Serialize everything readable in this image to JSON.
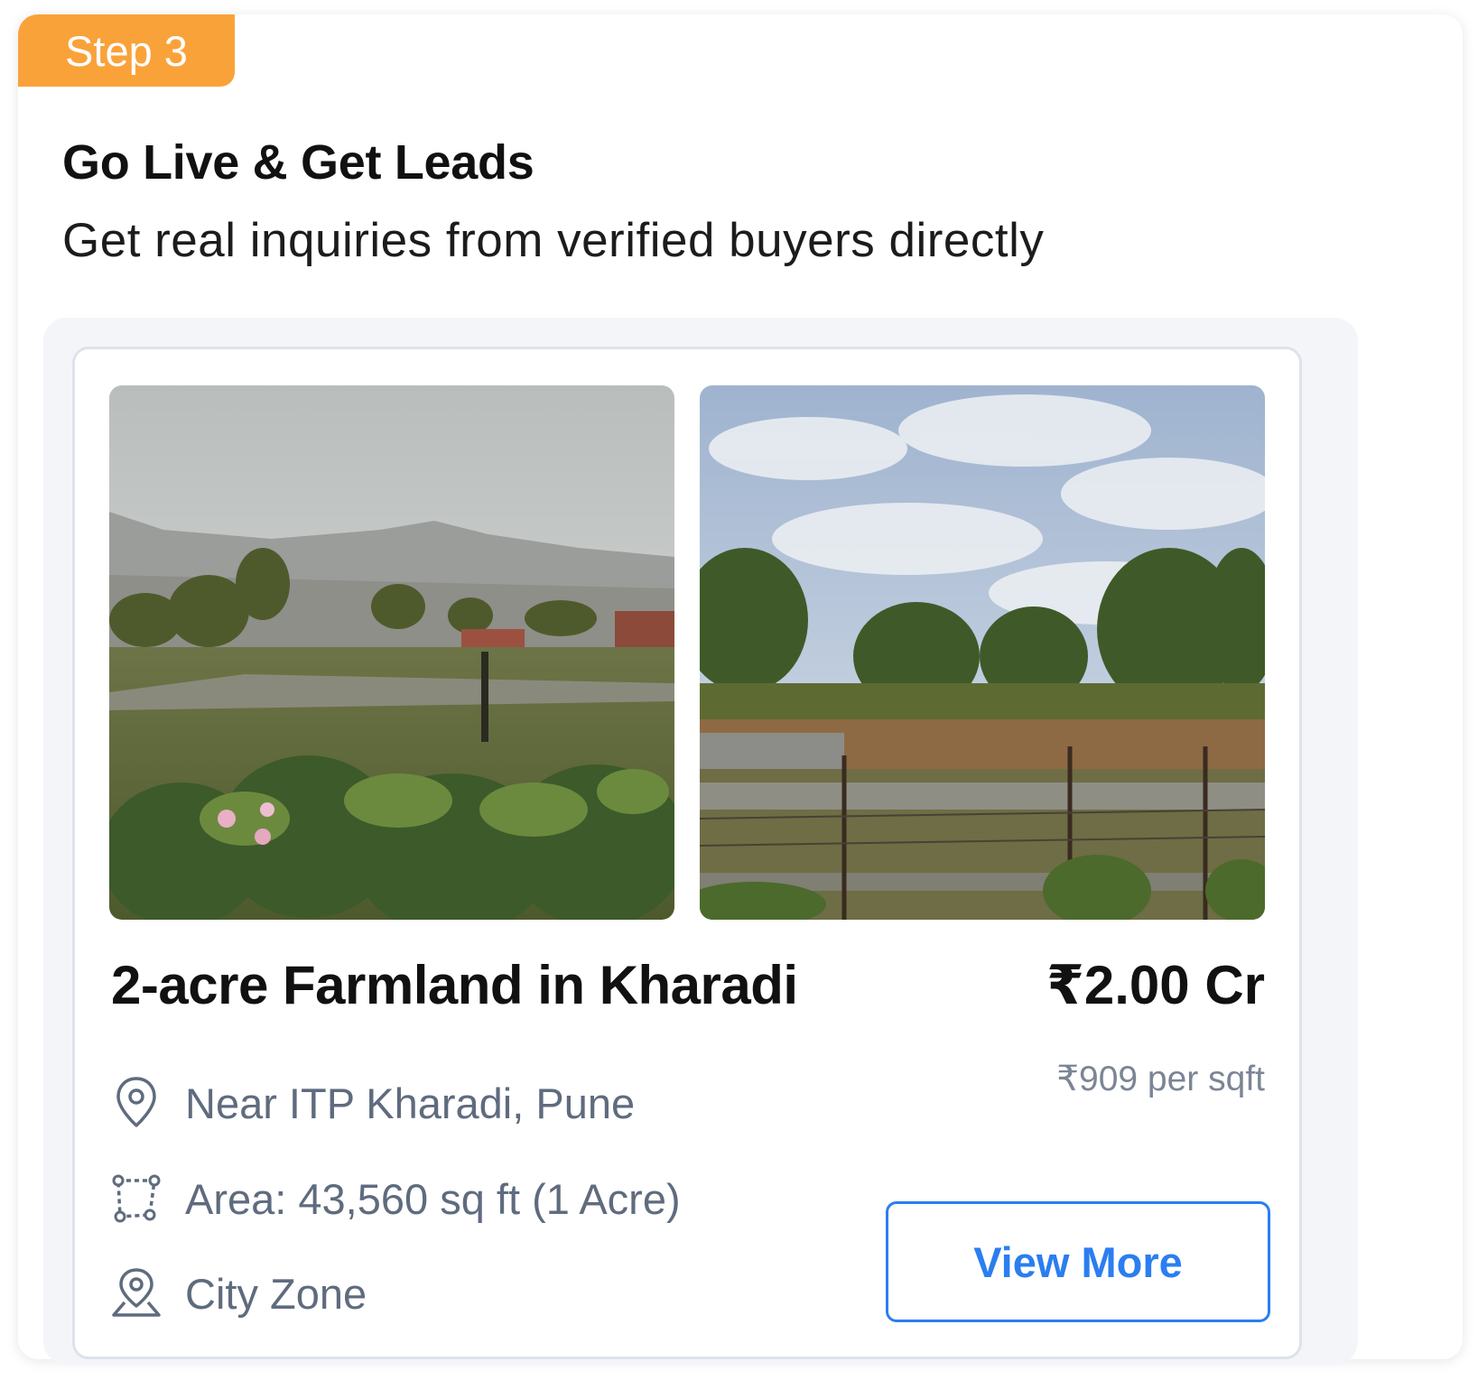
{
  "step": {
    "label": "Step 3"
  },
  "header": {
    "title": "Go Live & Get Leads",
    "subtitle": "Get real inquiries from verified buyers directly"
  },
  "listing": {
    "title": "2-acre Farmland in Kharadi",
    "price": "₹2.00 Cr",
    "price_per_unit": "₹909 per sqft",
    "location": "Near ITP Kharadi, Pune",
    "area": "Area: 43,560 sq ft (1 Acre)",
    "zone": "City Zone",
    "cta_label": "View More",
    "photos": [
      "farmland-photo-mountain-view",
      "farmland-photo-fenced-plot"
    ],
    "icons": {
      "location": "map-pin-icon",
      "area": "area-polygon-icon",
      "zone": "location-marker-icon"
    }
  },
  "colors": {
    "badge": "#FAA23A",
    "accent": "#2b7ef0",
    "muted_text": "#5f6b7e",
    "listing_bg": "#f3f5f9"
  }
}
